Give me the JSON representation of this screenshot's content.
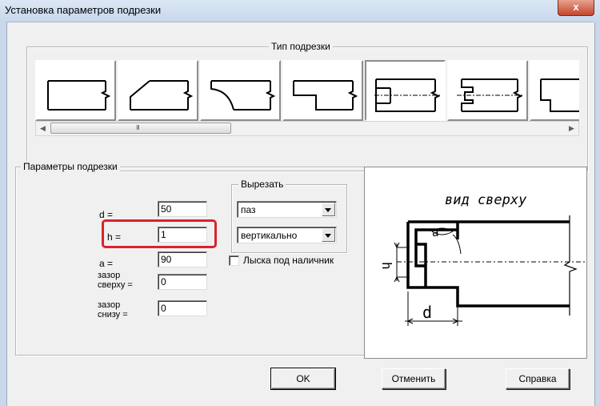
{
  "window": {
    "title": "Установка параметров подрезки",
    "close_glyph": "x"
  },
  "cut_type": {
    "legend": "Тип подрезки",
    "tiles": [
      {
        "icon": "cut-type-straight-icon"
      },
      {
        "icon": "cut-type-bevel-icon"
      },
      {
        "icon": "cut-type-curved-icon"
      },
      {
        "icon": "cut-type-step-icon"
      },
      {
        "icon": "cut-type-slot-icon",
        "selected": true
      },
      {
        "icon": "cut-type-slot-notched-icon"
      },
      {
        "icon": "cut-type-partial-icon"
      }
    ],
    "scroll_grip": "III"
  },
  "params": {
    "legend": "Параметры подрезки",
    "d_label": "d =",
    "d_value": "50",
    "h_label": "h =",
    "h_value": "1",
    "a_label": "a =",
    "a_value": "90",
    "gap_top_label_1": "зазор",
    "gap_top_label_2": "сверху =",
    "gap_top_value": "0",
    "gap_bottom_label_1": "зазор",
    "gap_bottom_label_2": "снизу =",
    "gap_bottom_value": "0",
    "cut_legend": "Вырезать",
    "cut_kind": "паз",
    "cut_orientation": "вертикально",
    "lyska_label": "Лыска под наличник",
    "lyska_checked": false
  },
  "preview": {
    "caption": "вид сверху",
    "dim_h": "h",
    "dim_d": "d",
    "dim_a": "a"
  },
  "buttons": {
    "ok": "OK",
    "cancel": "Отменить",
    "help": "Справка"
  },
  "colors": {
    "highlight": "#d9232d",
    "titlebar": "#c7d8ec",
    "close": "#c4462b"
  }
}
